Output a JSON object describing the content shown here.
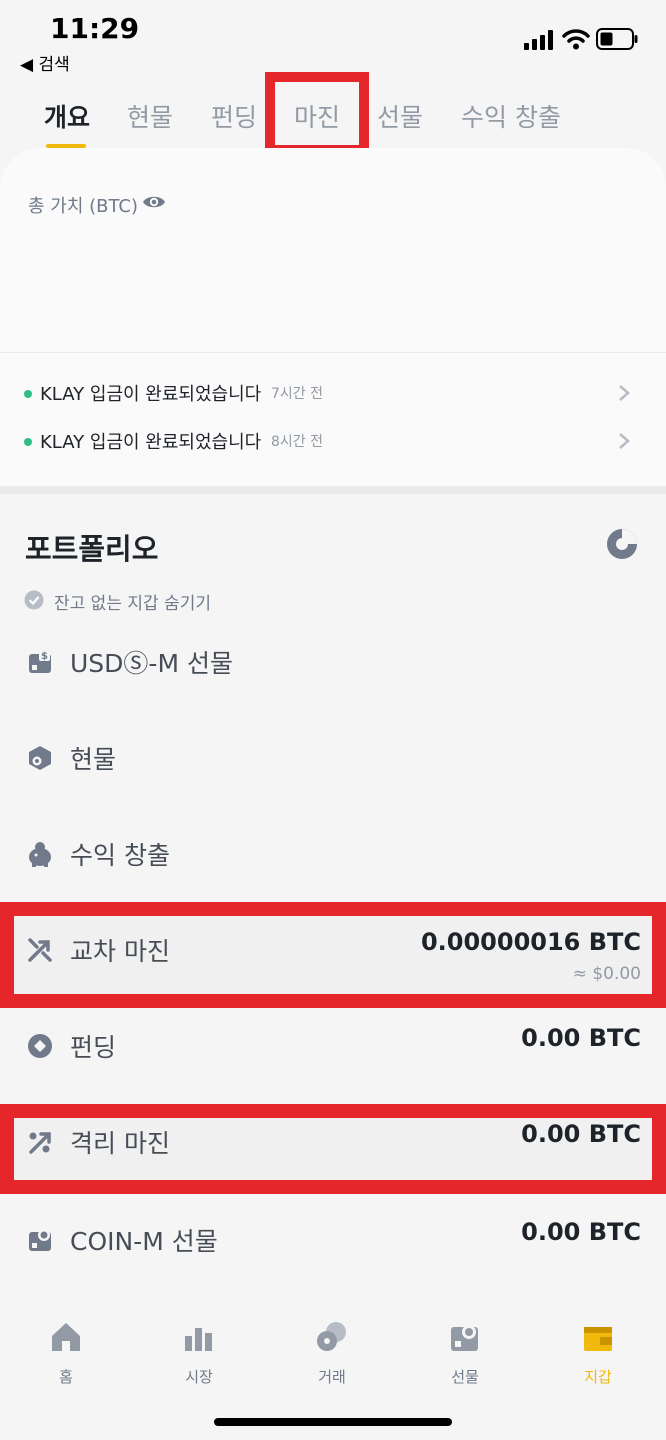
{
  "status_bar": {
    "time": "11:29",
    "back_label": "◀ 검색"
  },
  "tabs": [
    {
      "label": "개요",
      "active": true
    },
    {
      "label": "현물",
      "active": false
    },
    {
      "label": "펀딩",
      "active": false
    },
    {
      "label": "마진",
      "active": false
    },
    {
      "label": "선물",
      "active": false
    },
    {
      "label": "수익 창출",
      "active": false
    }
  ],
  "overview": {
    "total_label": "총 가치 (BTC)",
    "notices": [
      {
        "message": "KLAY 입금이 완료되었습니다",
        "ago": "7시간 전"
      },
      {
        "message": "KLAY 입금이 완료되었습니다",
        "ago": "8시간 전"
      }
    ]
  },
  "portfolio": {
    "title": "포트폴리오",
    "hide_zero_label": "잔고 없는 지갑 숨기기",
    "wallets": [
      {
        "name": "USDⓈ-M 선물",
        "amount": "",
        "sub": "",
        "icon": "usds-futures-icon"
      },
      {
        "name": "현물",
        "amount": "",
        "sub": "",
        "icon": "spot-icon"
      },
      {
        "name": "수익 창출",
        "amount": "",
        "sub": "",
        "icon": "earn-icon"
      },
      {
        "name": "교차 마진",
        "amount": "0.00000016 BTC",
        "sub": "≈ $0.00",
        "icon": "cross-margin-icon"
      },
      {
        "name": "펀딩",
        "amount": "0.00 BTC",
        "sub": "",
        "icon": "funding-icon"
      },
      {
        "name": "격리 마진",
        "amount": "0.00 BTC",
        "sub": "",
        "icon": "isolated-margin-icon"
      },
      {
        "name": "COIN-M 선물",
        "amount": "0.00 BTC",
        "sub": "",
        "icon": "coin-futures-icon"
      }
    ]
  },
  "bottom_nav": [
    {
      "label": "홈",
      "icon": "home-icon",
      "active": false
    },
    {
      "label": "시장",
      "icon": "markets-icon",
      "active": false
    },
    {
      "label": "거래",
      "icon": "trade-icon",
      "active": false
    },
    {
      "label": "선물",
      "icon": "futures-icon",
      "active": false
    },
    {
      "label": "지갑",
      "icon": "wallet-icon",
      "active": true
    }
  ],
  "colors": {
    "accent": "#f0b90b",
    "highlight": "#e5262a",
    "success_dot": "#2ebd85"
  }
}
